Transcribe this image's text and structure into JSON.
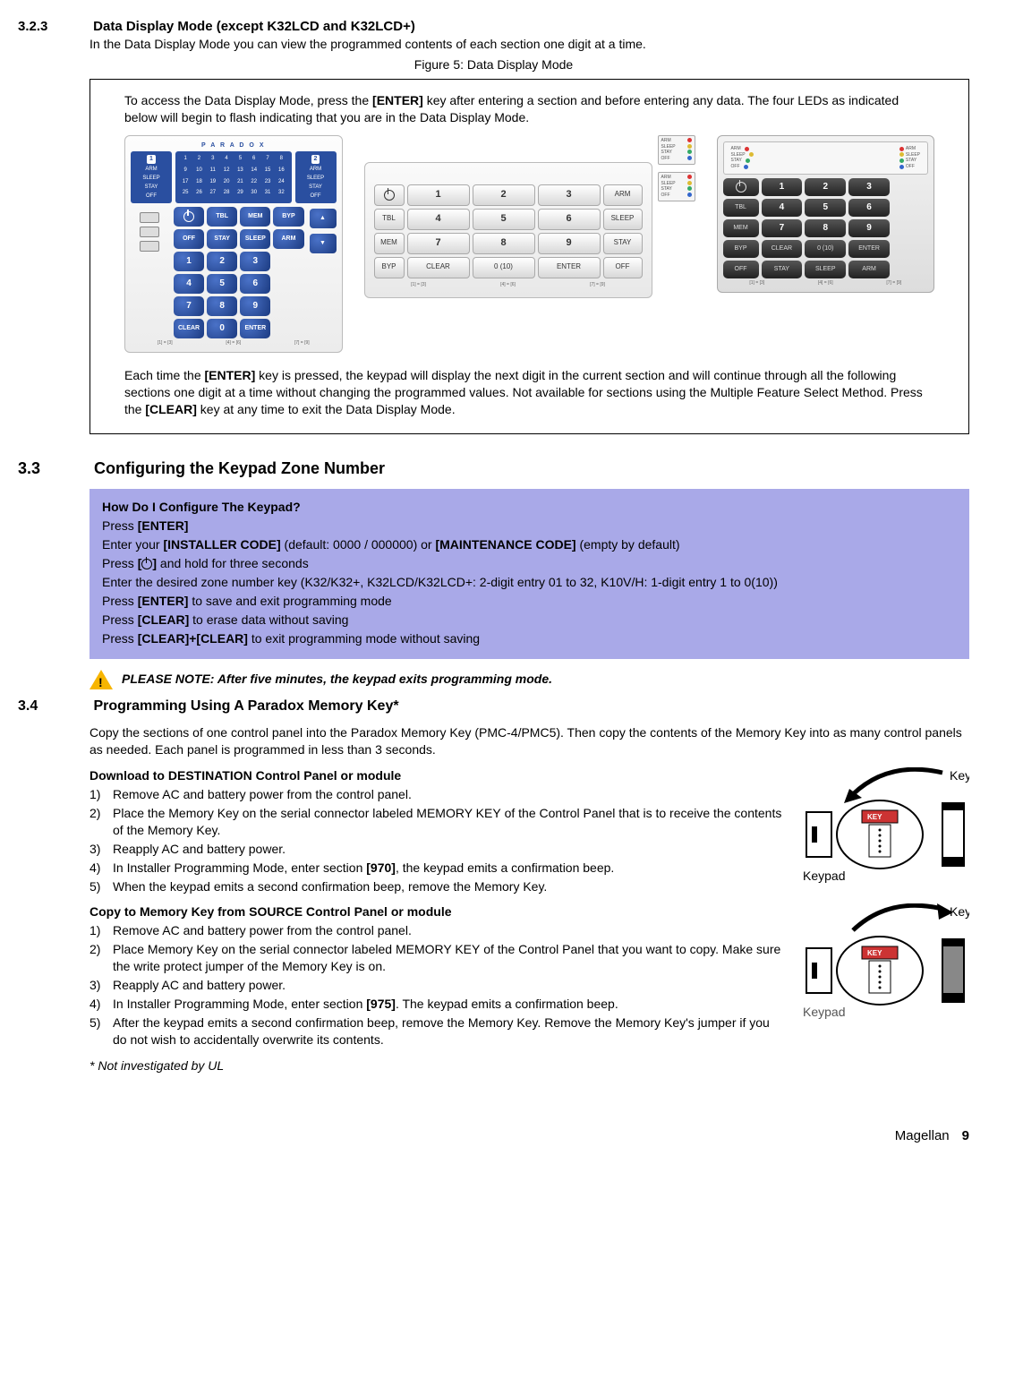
{
  "sec_323": {
    "num": "3.2.3",
    "title": "Data Display Mode (except K32LCD and K32LCD+)",
    "intro": "In the Data Display Mode you can view the programmed contents of each section one digit at a time.",
    "figure_caption": "Figure 5: Data Display Mode",
    "fig_top_a": "To access the Data Display Mode, press the ",
    "fig_top_enter": "[ENTER]",
    "fig_top_b": " key after entering a section and before entering any data. The four LEDs as indicated below will begin to flash indicating that you are in the Data Display Mode.",
    "fig_bot_a": "Each time the ",
    "fig_bot_enter": "[ENTER]",
    "fig_bot_b": " key is pressed, the keypad will display the next digit in the current section and will continue through all the following sections one digit at a time without changing the programmed values. Not available for sections using the Multiple Feature Select Method. Press the ",
    "fig_bot_clear": "[CLEAR]",
    "fig_bot_c": " key at any time to exit the Data Display Mode."
  },
  "keypad_common": {
    "status": [
      "ARM",
      "SLEEP",
      "STAY",
      "OFF"
    ],
    "func": [
      "TBL",
      "MEM",
      "BYP",
      "OFF",
      "STAY",
      "SLEEP",
      "ARM",
      "CLEAR",
      "ENTER"
    ],
    "zero_label": "0 (10)",
    "badges": [
      "1",
      "2"
    ],
    "brand": "P A R A D O X",
    "foot": [
      "[1] = [3]",
      "[4] = [6]",
      "[7] = [9]"
    ]
  },
  "zones": [
    "1",
    "2",
    "3",
    "4",
    "5",
    "6",
    "7",
    "8",
    "9",
    "10",
    "11",
    "12",
    "13",
    "14",
    "15",
    "16",
    "17",
    "18",
    "19",
    "20",
    "21",
    "22",
    "23",
    "24",
    "25",
    "26",
    "27",
    "28",
    "29",
    "30",
    "31",
    "32"
  ],
  "sec_33": {
    "num": "3.3",
    "title": "Configuring the Keypad Zone Number",
    "box_title": "How Do I Configure The Keypad?",
    "l1a": "Press ",
    "l1b": "[ENTER]",
    "l2a": "Enter your ",
    "l2b": "[INSTALLER CODE]",
    "l2c": " (default: 0000 / 000000) or ",
    "l2d": "[MAINTENANCE CODE]",
    "l2e": " (empty by default)",
    "l3a": "Press ",
    "l3b": "[",
    "l3c": "]",
    "l3d": " and hold for three seconds",
    "l4": "Enter the desired zone number key (K32/K32+, K32LCD/K32LCD+: 2-digit entry 01 to 32, K10V/H: 1-digit entry 1 to 0(10))",
    "l5a": "Press ",
    "l5b": "[ENTER]",
    "l5c": " to save and exit programming mode",
    "l6a": "Press ",
    "l6b": "[CLEAR]",
    "l6c": " to erase data without saving",
    "l7a": "Press ",
    "l7b": "[CLEAR]+[CLEAR]",
    "l7c": " to exit programming mode without saving",
    "note": "PLEASE NOTE: After five minutes, the keypad exits programming mode."
  },
  "sec_34": {
    "num": "3.4",
    "title": "Programming Using A Paradox Memory Key*",
    "intro": "Copy the sections of one control panel into the Paradox Memory Key (PMC-4/PMC5). Then copy the contents of the Memory Key into as many control panels as needed. Each panel is programmed in less than 3 seconds.",
    "dl_title": "Download to DESTINATION Control Panel or module",
    "dl": [
      {
        "n": "1)",
        "t": "Remove AC and battery power from the control panel."
      },
      {
        "n": "2)",
        "t_a": "Place the Memory Key on the serial connector labeled ",
        "t_sc": "MEMORY KEY",
        "t_b": " of the Control Panel that is to receive the contents of the Memory Key."
      },
      {
        "n": "3)",
        "t": "Reapply AC and battery power."
      },
      {
        "n": "4)",
        "t_a": "In Installer Programming Mode, enter section ",
        "t_b": "[970]",
        "t_c": ", the keypad emits a confirmation beep."
      },
      {
        "n": "5)",
        "t": "When the keypad emits a second confirmation beep, remove the Memory Key."
      }
    ],
    "cp_title": "Copy to Memory Key from SOURCE Control Panel or module",
    "cp": [
      {
        "n": "1)",
        "t": "Remove AC and battery power from the control panel."
      },
      {
        "n": "2)",
        "t_a": "Place Memory Key on the serial connector labeled ",
        "t_sc": "MEMORY KEY",
        "t_b": " of the Control Panel that you want to copy. Make sure the write protect jumper of the Memory Key is on."
      },
      {
        "n": "3)",
        "t": "Reapply AC and battery power."
      },
      {
        "n": "4)",
        "t_a": "In Installer Programming Mode, enter section ",
        "t_b": "[975]",
        "t_c": ". The keypad emits a confirmation beep."
      },
      {
        "n": "5)",
        "t": "After the keypad emits a second confirmation beep, remove the Memory Key. Remove the Memory Key's jumper if you do not wish to accidentally overwrite its contents."
      }
    ],
    "footnote": "* Not investigated by UL",
    "diagram": {
      "key": "Key",
      "keypad": "Keypad",
      "keylabel": "KEY"
    }
  },
  "footer": {
    "brand": "Magellan",
    "page": "9"
  }
}
